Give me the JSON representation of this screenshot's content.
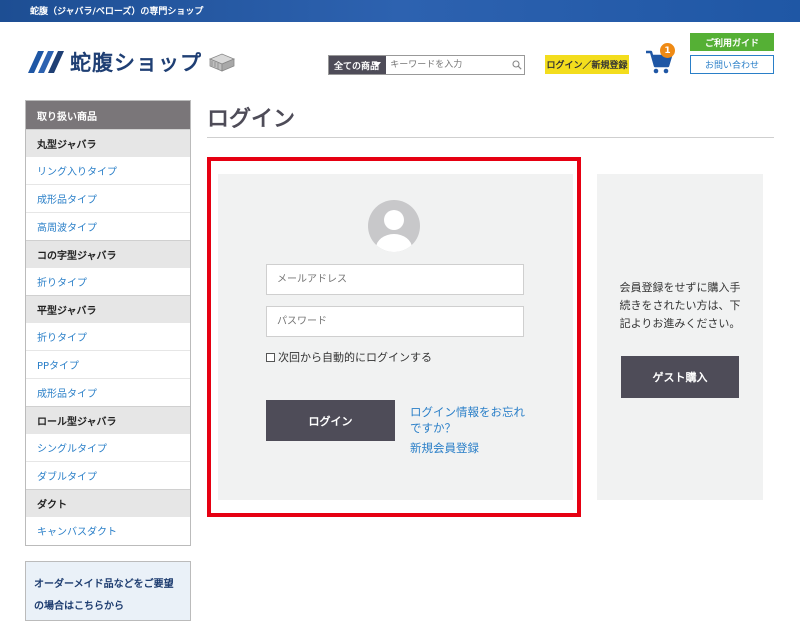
{
  "topbar": {
    "text": "蛇腹（ジャバラ/ベローズ）の専門ショップ"
  },
  "header": {
    "logo_text": "蛇腹ショップ",
    "search": {
      "category": "全ての商品",
      "placeholder": "キーワードを入力"
    },
    "login_register": "ログイン／新規登録",
    "cart_count": "1",
    "guide": "ご利用ガイド",
    "contact": "お問い合わせ"
  },
  "sidebar": {
    "heading": "取り扱い商品",
    "groups": [
      {
        "category": "丸型ジャバラ",
        "items": [
          "リング入りタイプ",
          "成形品タイプ",
          "高周波タイプ"
        ]
      },
      {
        "category": "コの字型ジャバラ",
        "items": [
          "折りタイプ"
        ]
      },
      {
        "category": "平型ジャバラ",
        "items": [
          "折りタイプ",
          "PPタイプ",
          "成形品タイプ"
        ]
      },
      {
        "category": "ロール型ジャバラ",
        "items": [
          "シングルタイプ",
          "ダブルタイプ"
        ]
      },
      {
        "category": "ダクト",
        "items": [
          "キャンバスダクト"
        ]
      }
    ],
    "order_box": {
      "line1": "オーダーメイド品などをご要望",
      "line2": "の場合はこちらから"
    }
  },
  "main": {
    "title": "ログイン",
    "login": {
      "email_placeholder": "メールアドレス",
      "password_placeholder": "パスワード",
      "remember_label": "次回から自動的にログインする",
      "remember_checked": false,
      "submit": "ログイン",
      "forgot": "ログイン情報をお忘れですか？",
      "register": "新規会員登録"
    },
    "guest": {
      "text": "会員登録をせずに購入手続きをされたい方は、下記よりお進みください。",
      "button": "ゲスト購入"
    }
  },
  "colors": {
    "brand_blue": "#1d4e93",
    "dark_button": "#4e4c58",
    "link_blue": "#2a7fc8",
    "highlight_red": "#e60012",
    "login_register_yellow": "#f3dd1d",
    "guide_green": "#55b035",
    "badge_orange": "#ef8a14"
  }
}
